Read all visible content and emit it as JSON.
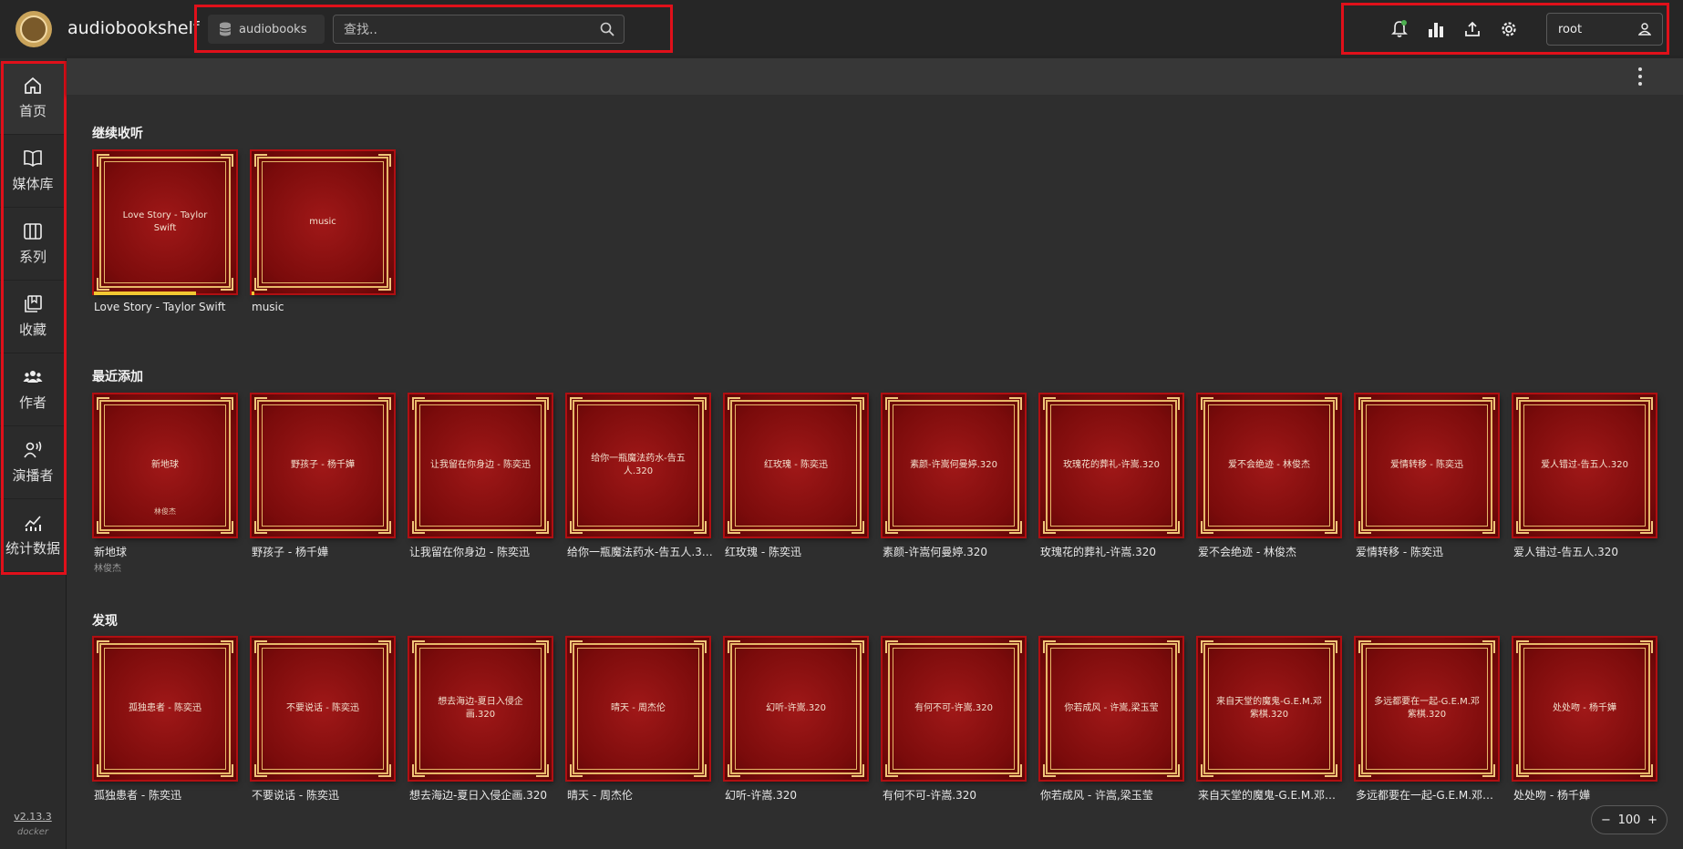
{
  "app": {
    "title": "audiobookshelf"
  },
  "header": {
    "library": "audiobooks",
    "search_placeholder": "查找..",
    "user": "root",
    "icons": [
      "bell-icon",
      "stats-icon",
      "upload-icon",
      "gear-icon",
      "user-icon"
    ]
  },
  "sidebar": {
    "items": [
      {
        "label": "首页",
        "icon": "home-icon"
      },
      {
        "label": "媒体库",
        "icon": "book-open-icon"
      },
      {
        "label": "系列",
        "icon": "columns-icon"
      },
      {
        "label": "收藏",
        "icon": "collection-icon"
      },
      {
        "label": "作者",
        "icon": "users-icon"
      },
      {
        "label": "演播者",
        "icon": "narrator-icon"
      },
      {
        "label": "统计数据",
        "icon": "chart-icon"
      }
    ],
    "version": "v2.13.3",
    "build": "docker"
  },
  "shelves": [
    {
      "title": "继续收听",
      "books": [
        {
          "cover": "Love Story - Taylor Swift",
          "title": "Love Story - Taylor Swift",
          "progress": 0.72
        },
        {
          "cover": "music",
          "title": "music",
          "progress": 0.02
        }
      ]
    },
    {
      "title": "最近添加",
      "books": [
        {
          "cover": "新地球",
          "cover_sub": "林俊杰",
          "title": "新地球",
          "author": "林俊杰"
        },
        {
          "cover": "野孩子 - 杨千嬅",
          "title": "野孩子 - 杨千嬅"
        },
        {
          "cover": "让我留在你身边 - 陈奕迅",
          "title": "让我留在你身边 - 陈奕迅"
        },
        {
          "cover": "给你一瓶魔法药水-告五人.320",
          "title": "给你一瓶魔法药水-告五人.320"
        },
        {
          "cover": "红玫瑰 - 陈奕迅",
          "title": "红玫瑰 - 陈奕迅"
        },
        {
          "cover": "素颜-许嵩何曼婷.320",
          "title": "素颜-许嵩何曼婷.320"
        },
        {
          "cover": "玫瑰花的葬礼-许嵩.320",
          "title": "玫瑰花的葬礼-许嵩.320"
        },
        {
          "cover": "爱不会绝迹 - 林俊杰",
          "title": "爱不会绝迹 - 林俊杰"
        },
        {
          "cover": "爱情转移 - 陈奕迅",
          "title": "爱情转移 - 陈奕迅"
        },
        {
          "cover": "爱人错过-告五人.320",
          "title": "爱人错过-告五人.320"
        }
      ]
    },
    {
      "title": "发现",
      "books": [
        {
          "cover": "孤独患者 - 陈奕迅",
          "title": "孤独患者 - 陈奕迅"
        },
        {
          "cover": "不要说话 - 陈奕迅",
          "title": "不要说话 - 陈奕迅"
        },
        {
          "cover": "想去海边-夏日入侵企画.320",
          "title": "想去海边-夏日入侵企画.320"
        },
        {
          "cover": "晴天 - 周杰伦",
          "title": "晴天 - 周杰伦"
        },
        {
          "cover": "幻听-许嵩.320",
          "title": "幻听-许嵩.320"
        },
        {
          "cover": "有何不可-许嵩.320",
          "title": "有何不可-许嵩.320"
        },
        {
          "cover": "你若成风 - 许嵩,梁玉莹",
          "title": "你若成风 - 许嵩,梁玉莹"
        },
        {
          "cover": "来自天堂的魔鬼-G.E.M.邓紫棋.320",
          "title": "来自天堂的魔鬼-G.E.M.邓紫棋.320"
        },
        {
          "cover": "多远都要在一起-G.E.M.邓紫棋.320",
          "title": "多远都要在一起-G.E.M.邓紫棋.320"
        },
        {
          "cover": "处处吻 - 杨千嬅",
          "title": "处处吻 - 杨千嬅"
        }
      ]
    }
  ],
  "zoom": {
    "minus": "−",
    "value": "100",
    "plus": "+"
  },
  "colors": {
    "highlight": "#e0101a",
    "cover": "#8a0e0e",
    "frame": "#e7b869",
    "progress": "#f2c832"
  }
}
